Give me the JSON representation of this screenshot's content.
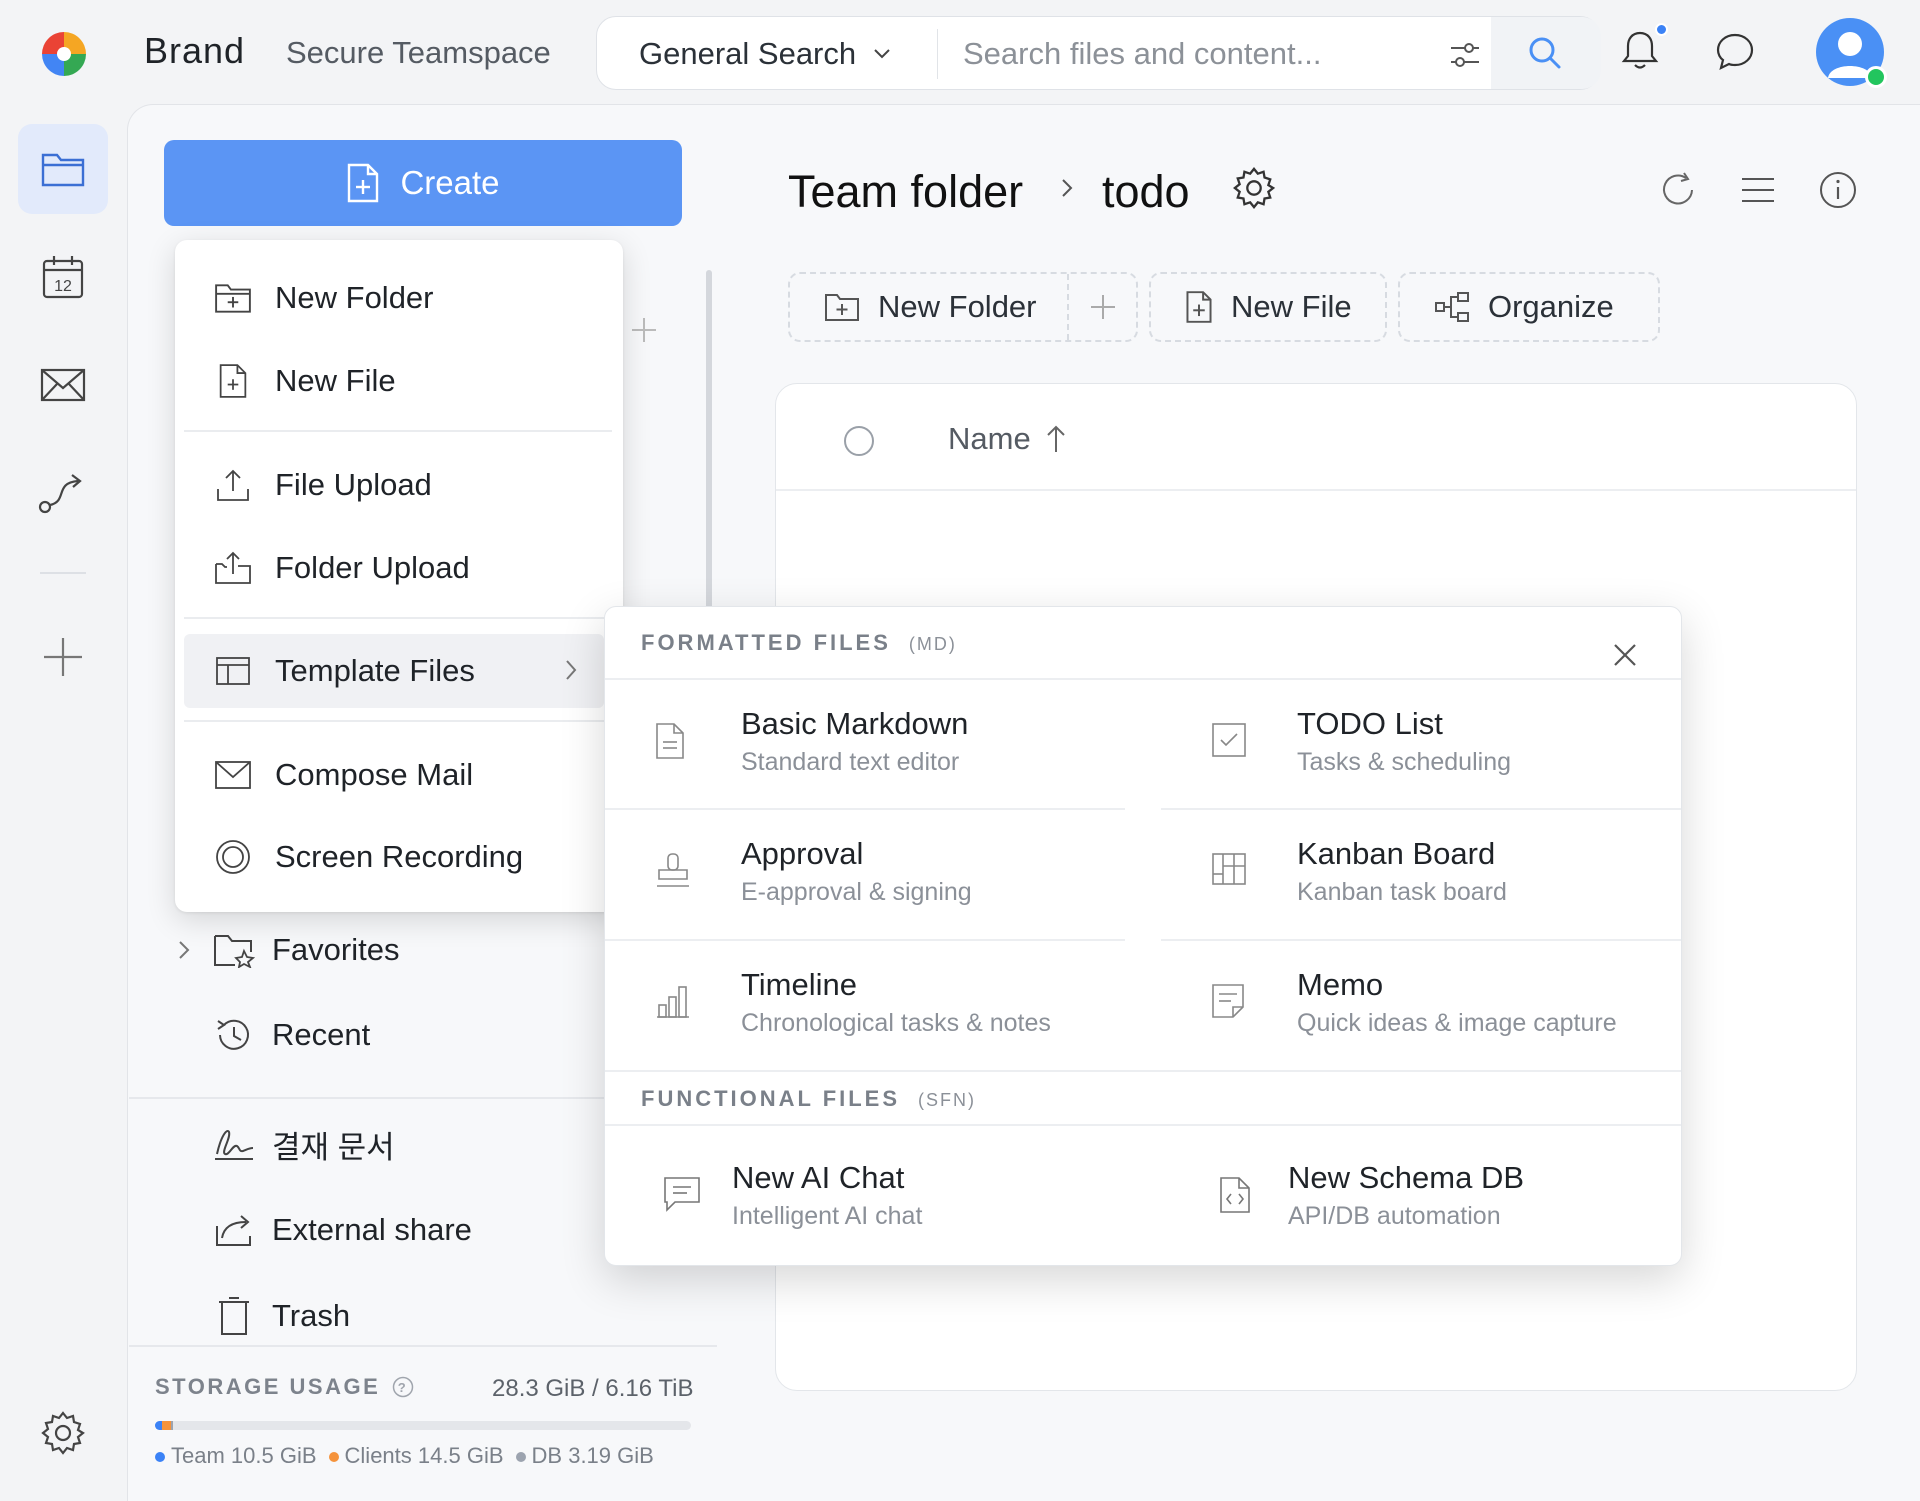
{
  "header": {
    "brand": "Brand",
    "workspace": "Secure Teamspace",
    "search_scope": "General Search",
    "search_placeholder": "Search files and content..."
  },
  "sidebar": {
    "create_label": "Create",
    "items": [
      {
        "label": "Favorites",
        "icon": "folder-star-icon"
      },
      {
        "label": "Recent",
        "icon": "history-icon"
      },
      {
        "label": "결재 문서",
        "icon": "signature-icon"
      },
      {
        "label": "External share",
        "icon": "share-icon"
      },
      {
        "label": "Trash",
        "icon": "trash-icon"
      }
    ],
    "storage": {
      "label": "STORAGE USAGE",
      "value": "28.3 GiB / 6.16 TiB",
      "used_fraction": 0.0045,
      "legend": [
        {
          "name": "Team",
          "value": "10.5 GiB",
          "color": "#3b82f6"
        },
        {
          "name": "Clients",
          "value": "14.5 GiB",
          "color": "#f5933c"
        },
        {
          "name": "DB",
          "value": "3.19 GiB",
          "color": "#9ca3af"
        }
      ]
    }
  },
  "create_menu": {
    "items": [
      {
        "label": "New Folder",
        "icon": "folder-plus-icon"
      },
      {
        "label": "New File",
        "icon": "file-plus-icon"
      },
      {
        "label": "File Upload",
        "icon": "upload-icon"
      },
      {
        "label": "Folder Upload",
        "icon": "folder-upload-icon"
      },
      {
        "label": "Template Files",
        "icon": "template-icon"
      },
      {
        "label": "Compose Mail",
        "icon": "mail-icon"
      },
      {
        "label": "Screen Recording",
        "icon": "record-icon"
      }
    ]
  },
  "templates": {
    "formatted_title": "FORMATTED FILES",
    "formatted_tag": "(MD)",
    "functional_title": "FUNCTIONAL FILES",
    "functional_tag": "(SFN)",
    "formatted": [
      {
        "title": "Basic Markdown",
        "subtitle": "Standard text editor",
        "icon": "document-icon"
      },
      {
        "title": "TODO List",
        "subtitle": "Tasks & scheduling",
        "icon": "checkbox-icon"
      },
      {
        "title": "Approval",
        "subtitle": "E-approval & signing",
        "icon": "stamp-icon"
      },
      {
        "title": "Kanban Board",
        "subtitle": "Kanban task board",
        "icon": "kanban-icon"
      },
      {
        "title": "Timeline",
        "subtitle": "Chronological tasks & notes",
        "icon": "bar-chart-icon"
      },
      {
        "title": "Memo",
        "subtitle": "Quick ideas & image capture",
        "icon": "memo-icon"
      }
    ],
    "functional": [
      {
        "title": "New AI Chat",
        "subtitle": "Intelligent AI chat",
        "icon": "chat-icon"
      },
      {
        "title": "New Schema DB",
        "subtitle": "API/DB automation",
        "icon": "code-file-icon"
      }
    ]
  },
  "main": {
    "breadcrumb": [
      "Team folder",
      "todo"
    ],
    "toolbar": {
      "new_folder": "New Folder",
      "new_file": "New File",
      "organize": "Organize"
    },
    "table": {
      "name_column": "Name"
    }
  },
  "colors": {
    "accent": "#5b95f4",
    "online": "#22c55e"
  }
}
